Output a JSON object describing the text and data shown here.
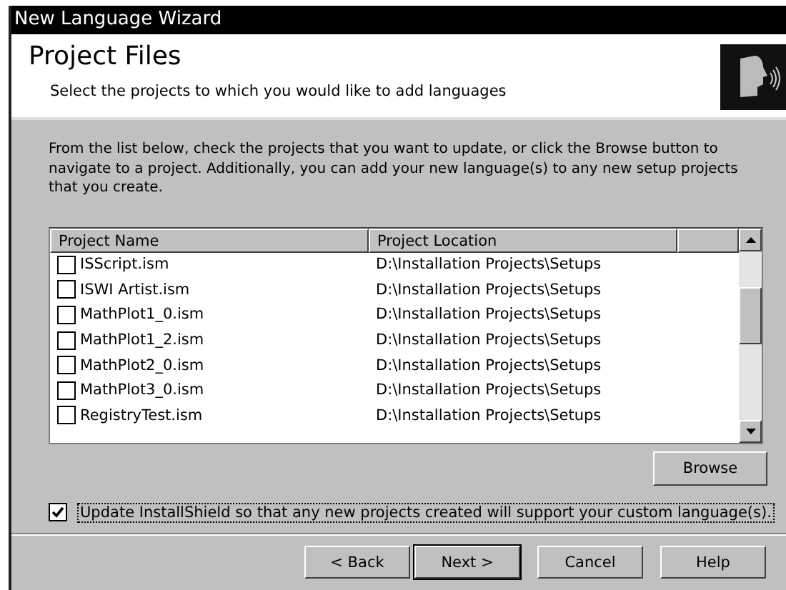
{
  "window": {
    "title": "New Language Wizard"
  },
  "header": {
    "title": "Project Files",
    "subtitle": "Select the projects to which you would like to add languages"
  },
  "instructions": "From the list below, check the projects that you want to update, or click the Browse button to navigate to a project.  Additionally, you can add your new language(s) to any new setup projects that you create.",
  "table": {
    "columns": [
      "Project Name",
      "Project Location"
    ],
    "rows": [
      {
        "name": "ISScript.ism",
        "location": "D:\\Installation Projects\\Setups",
        "checked": false
      },
      {
        "name": "ISWI Artist.ism",
        "location": "D:\\Installation Projects\\Setups",
        "checked": false
      },
      {
        "name": "MathPlot1_0.ism",
        "location": "D:\\Installation Projects\\Setups",
        "checked": false
      },
      {
        "name": "MathPlot1_2.ism",
        "location": "D:\\Installation Projects\\Setups",
        "checked": false
      },
      {
        "name": "MathPlot2_0.ism",
        "location": "D:\\Installation Projects\\Setups",
        "checked": false
      },
      {
        "name": "MathPlot3_0.ism",
        "location": "D:\\Installation Projects\\Setups",
        "checked": false
      },
      {
        "name": "RegistryTest.ism",
        "location": "D:\\Installation Projects\\Setups",
        "checked": false
      }
    ]
  },
  "browse_button": "Browse",
  "update_option": {
    "label": "Update InstallShield so that any new projects created will support your custom language(s).",
    "checked": true
  },
  "buttons": [
    {
      "label": "< Back",
      "default": false
    },
    {
      "label": "Next >",
      "default": true
    },
    {
      "label": "Cancel",
      "default": false
    },
    {
      "label": "Help",
      "default": false
    }
  ]
}
